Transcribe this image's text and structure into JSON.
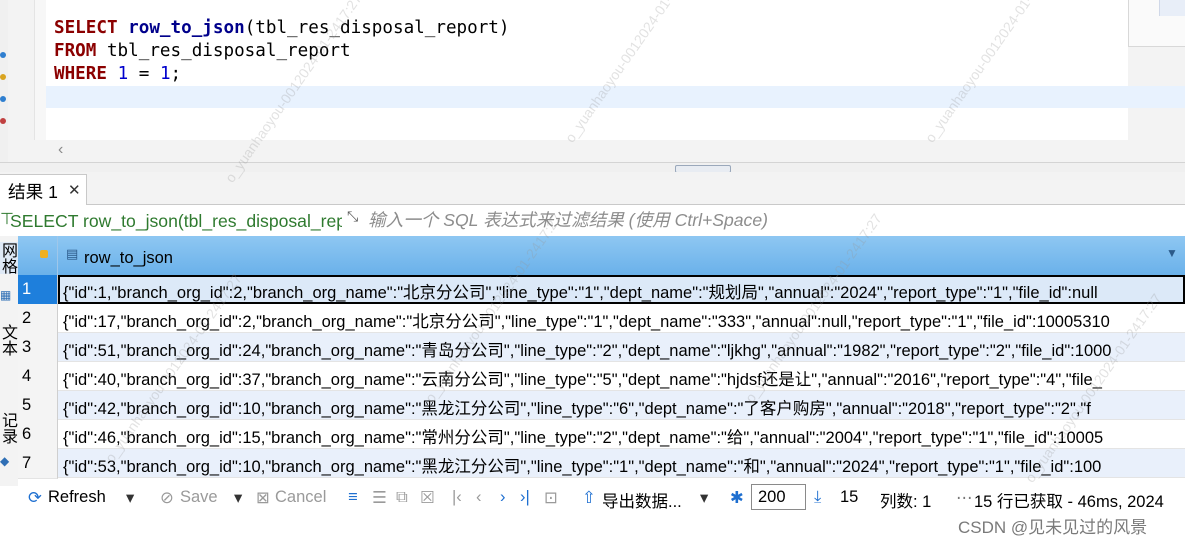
{
  "editor": {
    "lines": [
      [
        {
          "t": "SELECT ",
          "c": "kw"
        },
        {
          "t": "row_to_json",
          "c": "fn"
        },
        {
          "t": "(tbl_res_disposal_report)",
          "c": ""
        }
      ],
      [
        {
          "t": "FROM ",
          "c": "kw"
        },
        {
          "t": "tbl_res_disposal_report",
          "c": ""
        }
      ],
      [
        {
          "t": "WHERE ",
          "c": "kw"
        },
        {
          "t": "1",
          "c": "num"
        },
        {
          "t": " = ",
          "c": ""
        },
        {
          "t": "1",
          "c": "num"
        },
        {
          "t": ";",
          "c": ""
        }
      ]
    ]
  },
  "result_tab": {
    "label": "结果 1",
    "close": "✕"
  },
  "filter": {
    "query_text": "SELECT row_to_json(tbl_res_disposal_report",
    "placeholder": "输入一个 SQL 表达式来过滤结果 (使用 Ctrl+Space)"
  },
  "side_tabs": [
    "网格",
    "文本",
    "记录"
  ],
  "grid": {
    "column": "row_to_json",
    "selected_row": 1,
    "rows": [
      {
        "n": "1",
        "v": "{\"id\":1,\"branch_org_id\":2,\"branch_org_name\":\"北京分公司\",\"line_type\":\"1\",\"dept_name\":\"规划局\",\"annual\":\"2024\",\"report_type\":\"1\",\"file_id\":null"
      },
      {
        "n": "2",
        "v": "{\"id\":17,\"branch_org_id\":2,\"branch_org_name\":\"北京分公司\",\"line_type\":\"1\",\"dept_name\":\"333\",\"annual\":null,\"report_type\":\"1\",\"file_id\":10005310"
      },
      {
        "n": "3",
        "v": "{\"id\":51,\"branch_org_id\":24,\"branch_org_name\":\"青岛分公司\",\"line_type\":\"2\",\"dept_name\":\"ljkhg\",\"annual\":\"1982\",\"report_type\":\"2\",\"file_id\":1000"
      },
      {
        "n": "4",
        "v": "{\"id\":40,\"branch_org_id\":37,\"branch_org_name\":\"云南分公司\",\"line_type\":\"5\",\"dept_name\":\"hjdsf还是让\",\"annual\":\"2016\",\"report_type\":\"4\",\"file_"
      },
      {
        "n": "5",
        "v": "{\"id\":42,\"branch_org_id\":10,\"branch_org_name\":\"黑龙江分公司\",\"line_type\":\"6\",\"dept_name\":\"了客户购房\",\"annual\":\"2018\",\"report_type\":\"2\",\"f"
      },
      {
        "n": "6",
        "v": "{\"id\":46,\"branch_org_id\":15,\"branch_org_name\":\"常州分公司\",\"line_type\":\"2\",\"dept_name\":\"给\",\"annual\":\"2004\",\"report_type\":\"1\",\"file_id\":10005"
      },
      {
        "n": "7",
        "v": "{\"id\":53,\"branch_org_id\":10,\"branch_org_name\":\"黑龙江分公司\",\"line_type\":\"1\",\"dept_name\":\"和\",\"annual\":\"2024\",\"report_type\":\"1\",\"file_id\":100"
      }
    ]
  },
  "toolbar": {
    "refresh": "Refresh",
    "save": "Save",
    "cancel": "Cancel",
    "export": "导出数据...",
    "fetch_size": "200",
    "row_count": "15",
    "column_count": "列数: 1",
    "status": "15 行已获取 - 46ms, 2024"
  },
  "watermark": "CSDN @见未见过的风景",
  "overlay_watermark": "o_yuanhaoyou-0012024-01-2417:27",
  "colors": {
    "header": "#6ab1ea",
    "selected_row": "#1e7fdc",
    "keyword": "#8b0000"
  }
}
